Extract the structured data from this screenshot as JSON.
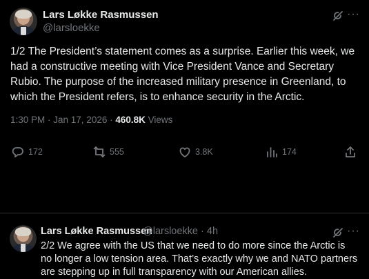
{
  "tweet1": {
    "author_name": "Lars Løkke Rasmussen",
    "author_handle": "@larsloekke",
    "text": "1/2 The President’s statement comes as a surprise. Earlier this week, we had a constructive meeting with Vice President Vance and Secretary Rubio. The purpose of the increased military presence in Greenland, to which the President refers, is to enhance security in the Arctic.",
    "time": "1:30 PM · Jan 17, 2026 · ",
    "views_count": "460.8K",
    "views_label": " Views",
    "replies": "172",
    "reposts": "555",
    "likes": "3.8K",
    "bookmarks": "174"
  },
  "tweet2": {
    "author_name": "Lars Løkke Rasmussen",
    "author_handle": "@larsloekke · 4h",
    "text": "2/2 We agree with the US that we need to do more since the Arctic is no longer a low tension area. That’s exactly why we and NATO partners are stepping up in full transparency with our American allies."
  },
  "icons": [
    "grok-icon",
    "more-icon",
    "reply-icon",
    "repost-icon",
    "like-icon",
    "views-icon",
    "share-icon"
  ]
}
